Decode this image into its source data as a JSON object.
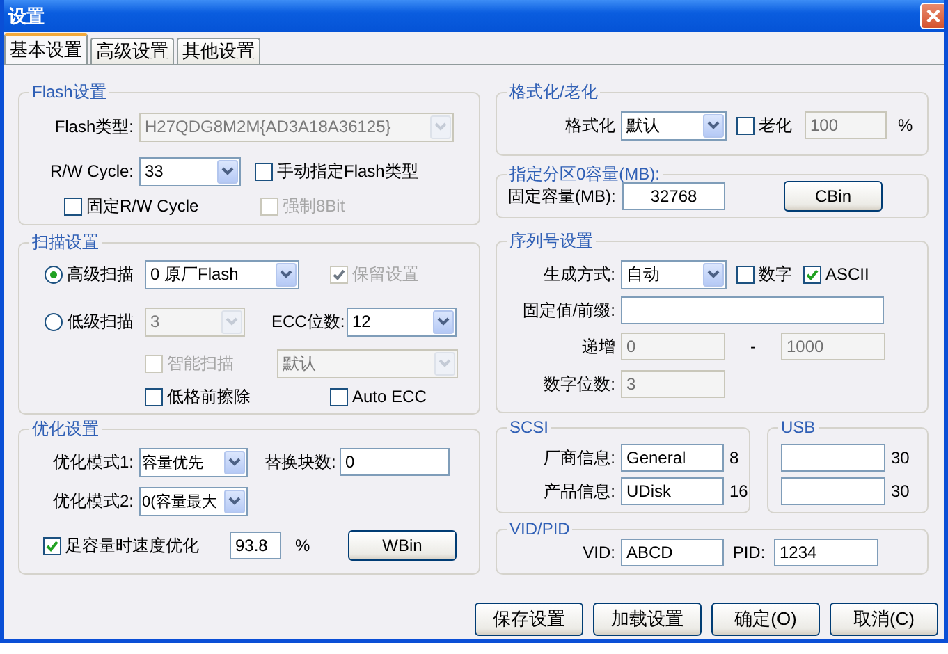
{
  "window": {
    "title": "设置"
  },
  "tabs": [
    {
      "label": "基本设置",
      "selected": true
    },
    {
      "label": "高级设置",
      "selected": false
    },
    {
      "label": "其他设置",
      "selected": false
    }
  ],
  "flash": {
    "title": "Flash设置",
    "type_label": "Flash类型:",
    "type": {
      "value": "H27QDG8M2M{AD3A18A36125}",
      "disabled": true
    },
    "cycle_label": "R/W Cycle:",
    "cycle": {
      "value": "33",
      "disabled": false
    },
    "manual": {
      "label": "手动指定Flash类型",
      "checked": false,
      "disabled": false
    },
    "fixed_cycle": {
      "label": "固定R/W Cycle",
      "checked": false,
      "disabled": false
    },
    "force8bit": {
      "label": "强制8Bit",
      "checked": false,
      "disabled": true
    }
  },
  "scan": {
    "title": "扫描设置",
    "high": {
      "label": "高级扫描",
      "selected": true
    },
    "high_mode": {
      "value": "0 原厂Flash",
      "disabled": false
    },
    "keep": {
      "label": "保留设置",
      "checked": true,
      "disabled": true
    },
    "low": {
      "label": "低级扫描",
      "selected": false
    },
    "low_mode": {
      "value": "3",
      "disabled": true
    },
    "ecc_label": "ECC位数:",
    "ecc": {
      "value": "12",
      "disabled": false
    },
    "smart": {
      "label": "智能扫描",
      "checked": false,
      "disabled": true
    },
    "smart_mode": {
      "value": "默认",
      "disabled": true
    },
    "erase": {
      "label": "低格前擦除",
      "checked": false,
      "disabled": false
    },
    "auto_ecc": {
      "label": "Auto ECC",
      "checked": false,
      "disabled": false
    }
  },
  "optimize": {
    "title": "优化设置",
    "mode1_label": "优化模式1:",
    "mode1": {
      "value": "容量优先",
      "disabled": false
    },
    "replace_label": "替换块数:",
    "replace": {
      "value": "0",
      "disabled": false
    },
    "mode2_label": "优化模式2:",
    "mode2": {
      "value": "0(容量最大",
      "disabled": false
    },
    "speed": {
      "label": "足容量时速度优化",
      "checked": true,
      "disabled": false
    },
    "speed_value": {
      "value": "93.8",
      "disabled": false
    },
    "speed_unit": "%",
    "wbin": "WBin"
  },
  "format": {
    "title": "格式化/老化",
    "format_label": "格式化",
    "format": {
      "value": "默认",
      "disabled": false
    },
    "aging": {
      "label": "老化",
      "checked": false,
      "disabled": false
    },
    "aging_value": {
      "value": "100",
      "disabled": true
    },
    "aging_unit": "%"
  },
  "partition": {
    "title": "指定分区0容量(MB):",
    "size_label": "固定容量(MB):",
    "size": {
      "value": "32768",
      "disabled": false
    },
    "cbin": "CBin"
  },
  "serial": {
    "title": "序列号设置",
    "mode_label": "生成方式:",
    "mode": {
      "value": "自动",
      "disabled": false
    },
    "digits": {
      "label": "数字",
      "checked": false,
      "disabled": false
    },
    "ascii": {
      "label": "ASCII",
      "checked": true,
      "disabled": false
    },
    "prefix_label": "固定值/前缀:",
    "prefix": {
      "disabled": false
    },
    "inc_label": "递增",
    "inc_from": {
      "value": "0",
      "disabled": true
    },
    "inc_sep": "-",
    "inc_to": {
      "value": "1000",
      "disabled": true
    },
    "count_label": "数字位数:",
    "count": {
      "value": "3",
      "disabled": true
    }
  },
  "scsi": {
    "title": "SCSI",
    "vendor_label": "厂商信息:",
    "vendor": {
      "value": "General",
      "disabled": false
    },
    "vendor_len": "8",
    "product_label": "产品信息:",
    "product": {
      "value": "UDisk",
      "disabled": false
    },
    "product_len": "16"
  },
  "usb": {
    "title": "USB",
    "vendor": {
      "disabled": false
    },
    "vendor_len": "30",
    "product": {
      "disabled": false
    },
    "product_len": "30"
  },
  "vidpid": {
    "title": "VID/PID",
    "vid_label": "VID:",
    "vid": {
      "value": "ABCD",
      "disabled": false
    },
    "pid_label": "PID:",
    "pid": {
      "value": "1234",
      "disabled": false
    }
  },
  "buttons": [
    {
      "label": "保存设置"
    },
    {
      "label": "加载设置"
    },
    {
      "label": "确定(O)"
    },
    {
      "label": "取消(C)"
    }
  ]
}
